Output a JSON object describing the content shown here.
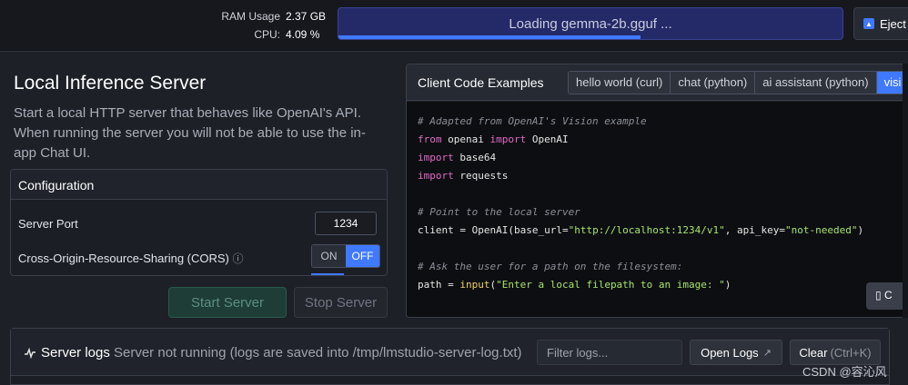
{
  "stats": {
    "ram_label": "RAM Usage",
    "ram_value": "2.37 GB",
    "cpu_label": "CPU:",
    "cpu_value": "4.09 %"
  },
  "loading": {
    "text": "Loading gemma-2b.gguf ...",
    "progress_percent": 60
  },
  "eject": {
    "label": "Eject"
  },
  "server": {
    "title": "Local Inference Server",
    "description": "Start a local HTTP server that behaves like OpenAI's API. When running the server you will not be able to use the in-app Chat UI."
  },
  "config": {
    "heading": "Configuration",
    "port_label": "Server Port",
    "port_value": "1234",
    "cors_label": "Cross-Origin-Resource-Sharing (CORS)",
    "cors_on": "ON",
    "cors_off": "OFF"
  },
  "buttons": {
    "start": "Start Server",
    "stop": "Stop Server"
  },
  "code_panel": {
    "title": "Client Code Examples",
    "tabs": [
      "hello world (curl)",
      "chat (python)",
      "ai assistant (python)",
      "visi"
    ],
    "lines": {
      "l1": "# Adapted from OpenAI's Vision example",
      "l2_kw": "from",
      "l2_mod": " openai ",
      "l2_kw2": "import",
      "l2_name": " OpenAI",
      "l3_kw": "import",
      "l3_name": " base64",
      "l4_kw": "import",
      "l4_name": " requests",
      "l6": "# Point to the local server",
      "l7_pre": "client = OpenAI(base_url=",
      "l7_url": "\"http://localhost:1234/v1\"",
      "l7_mid": ", api_key=",
      "l7_key": "\"not-needed\"",
      "l7_end": ")",
      "l9": "# Ask the user for a path on the filesystem:",
      "l10_pre": "path = ",
      "l10_fn": "input",
      "l10_open": "(",
      "l10_str": "\"Enter a local filepath to an image: \"",
      "l10_end": ")"
    },
    "copy_label": "C"
  },
  "logs": {
    "title": "Server logs",
    "status": "Server not running (logs are saved into /tmp/lmstudio-server-log.txt)",
    "filter_placeholder": "Filter logs...",
    "open_label": "Open Logs",
    "clear_label": "Clear",
    "clear_shortcut": "(Ctrl+K)"
  },
  "watermark": "CSDN @容沁风"
}
